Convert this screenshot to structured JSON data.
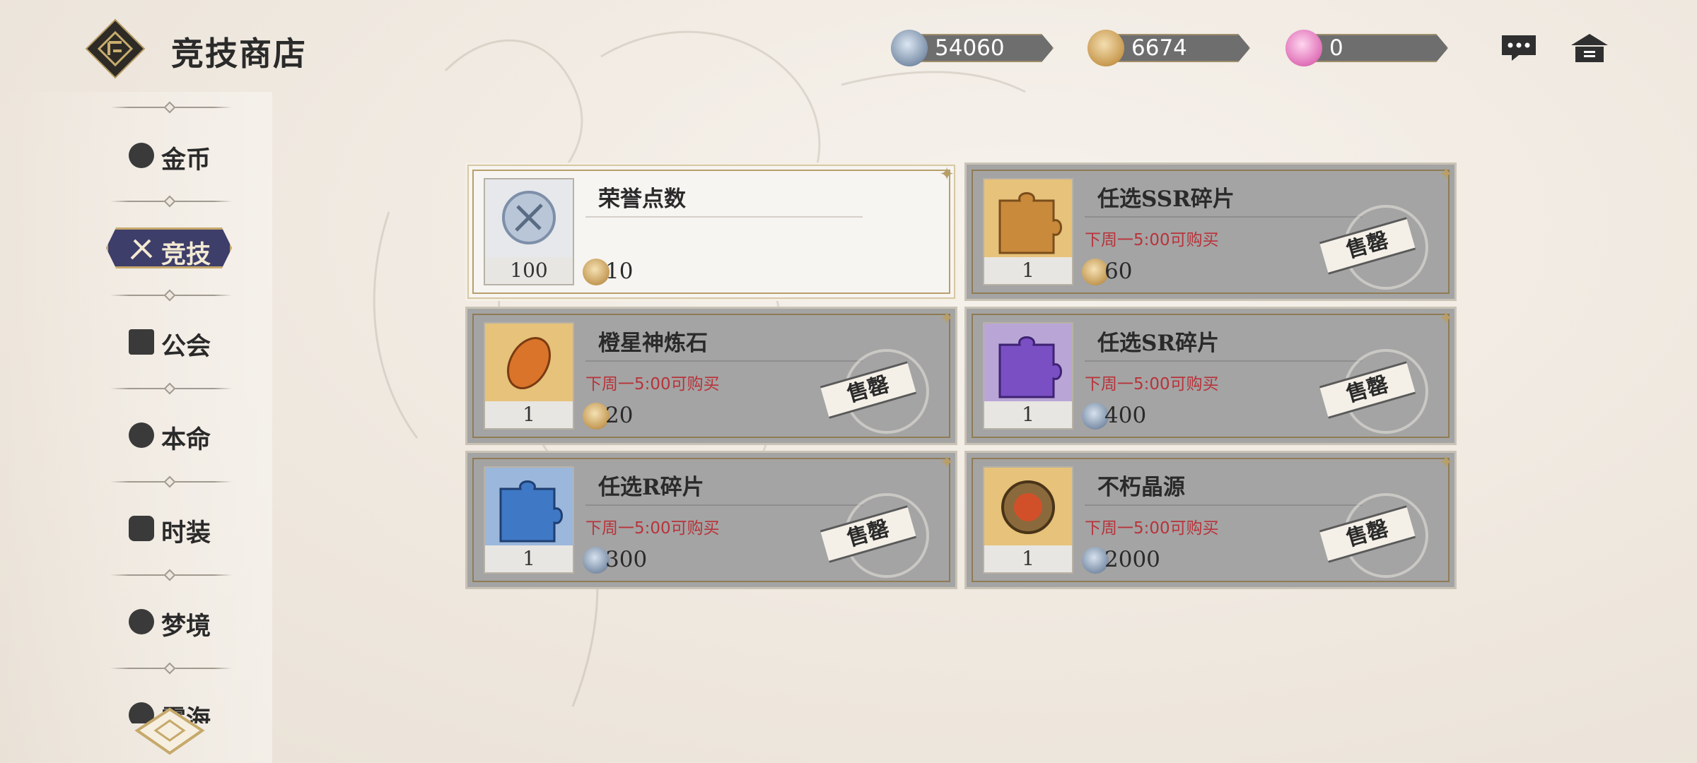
{
  "header": {
    "title": "竞技商店",
    "currencies": [
      {
        "icon": "honor-point-icon",
        "value": "54060"
      },
      {
        "icon": "arena-coin-icon",
        "value": "6674"
      },
      {
        "icon": "pink-crystal-icon",
        "value": "0"
      }
    ],
    "icons": [
      "chat-icon",
      "home-icon"
    ]
  },
  "sidebar": {
    "items": [
      {
        "label": "金币",
        "icon": "coin-icon"
      },
      {
        "label": "竞技",
        "icon": "swords-icon",
        "active": true
      },
      {
        "label": "公会",
        "icon": "guild-icon"
      },
      {
        "label": "本命",
        "icon": "rune-icon"
      },
      {
        "label": "时装",
        "icon": "costume-icon"
      },
      {
        "label": "梦境",
        "icon": "moon-icon"
      },
      {
        "label": "雾海",
        "icon": "mist-icon"
      }
    ]
  },
  "shop": {
    "items": [
      {
        "name": "荣誉点数",
        "qty": "100",
        "price": "10",
        "price_icon": "arena-coin-icon",
        "restock": "",
        "sold_out": false
      },
      {
        "name": "任选SSR碎片",
        "qty": "1",
        "price": "60",
        "price_icon": "arena-coin-icon",
        "restock": "下周一5:00可购买",
        "sold_out": true,
        "stamp": "售罄"
      },
      {
        "name": "橙星神炼石",
        "qty": "1",
        "price": "20",
        "price_icon": "arena-coin-icon",
        "restock": "下周一5:00可购买",
        "sold_out": true,
        "stamp": "售罄"
      },
      {
        "name": "任选SR碎片",
        "qty": "1",
        "price": "400",
        "price_icon": "honor-point-icon",
        "restock": "下周一5:00可购买",
        "sold_out": true,
        "stamp": "售罄"
      },
      {
        "name": "任选R碎片",
        "qty": "1",
        "price": "300",
        "price_icon": "honor-point-icon",
        "restock": "下周一5:00可购买",
        "sold_out": true,
        "stamp": "售罄"
      },
      {
        "name": "不朽晶源",
        "qty": "1",
        "price": "2000",
        "price_icon": "honor-point-icon",
        "restock": "下周一5:00可购买",
        "sold_out": true,
        "stamp": "售罄"
      }
    ]
  },
  "colors": {
    "accent_gold": "#c6a96b",
    "active_nav": "#3e3e6a",
    "restock_red": "#b8333a",
    "sold_card": "#a4a4a4"
  }
}
